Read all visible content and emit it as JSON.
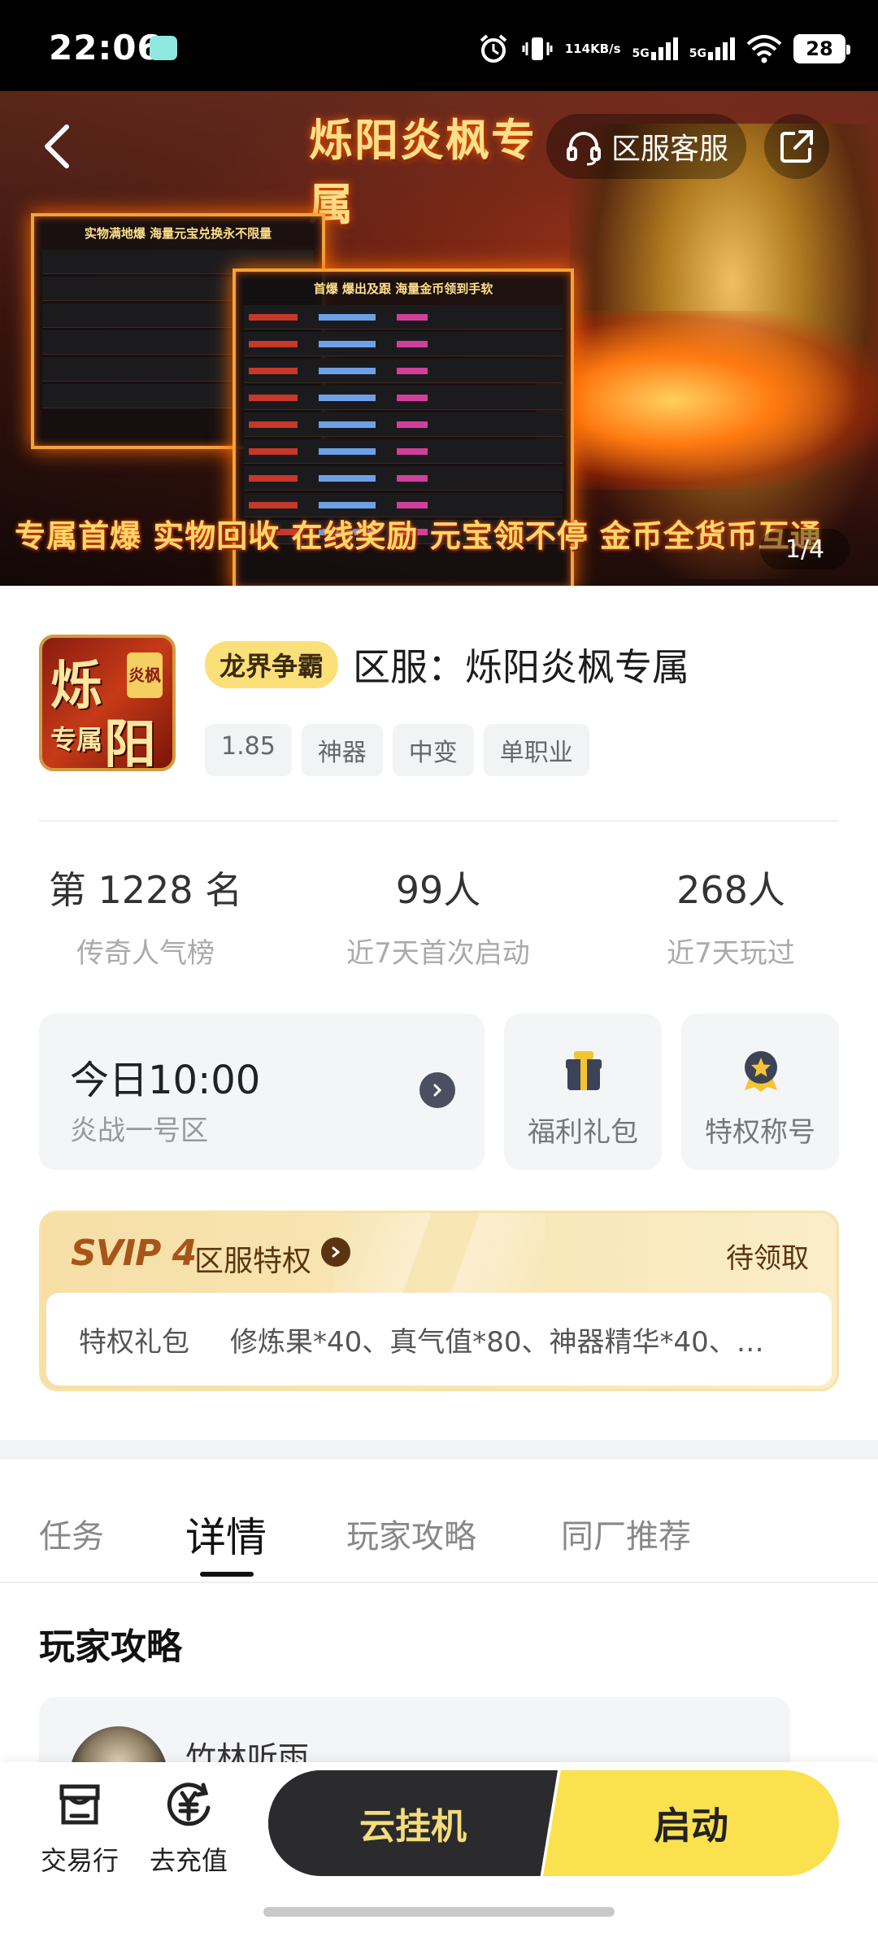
{
  "status_bar": {
    "time": "22:06",
    "net_speed_value": "114",
    "net_speed_unit": "KB/s",
    "signal_1": "5G",
    "signal_2": "5G",
    "battery": "28",
    "icons": [
      "alarm-icon",
      "vibrate-icon",
      "wifi-icon",
      "battery-icon"
    ]
  },
  "banner": {
    "title": "烁阳炎枫专属",
    "panel_left_title": "实物满地爆  海量元宝兑换永不限量",
    "panel_right_title": "首爆 爆出及跟  海量金币领到手软",
    "tagline": "专属首爆 实物回收 在线奖励 元宝领不停 金币全货币互通",
    "page_indicator": "1/4",
    "customer_service_label": "区服客服"
  },
  "game": {
    "logo_text": [
      "烁",
      "炎枫",
      "专属",
      "阳"
    ],
    "category": "龙界争霸",
    "title": "区服：烁阳炎枫专属",
    "tags": [
      "1.85",
      "神器",
      "中变",
      "单职业"
    ]
  },
  "stats": [
    {
      "value": "第 1228 名",
      "label": "传奇人气榜"
    },
    {
      "value": "99人",
      "label": "近7天首次启动"
    },
    {
      "value": "268人",
      "label": "近7天玩过"
    }
  ],
  "server": {
    "time": "今日10:00",
    "name": "炎战一号区"
  },
  "quick_cards": [
    {
      "label": "福利礼包",
      "icon": "gift-box-icon"
    },
    {
      "label": "特权称号",
      "icon": "star-medal-icon"
    }
  ],
  "svip": {
    "level": "SVIP 4",
    "title": "区服特权",
    "status": "待领取",
    "gift_label": "特权礼包",
    "gift_desc": "修炼果*40、真气值*80、神器精华*40、…"
  },
  "tabs": [
    "任务",
    "详情",
    "玩家攻略",
    "同厂推荐"
  ],
  "active_tab": "详情",
  "guides": {
    "section_title": "玩家攻略",
    "author": "竹林听雨"
  },
  "bottom_bar": {
    "trade_label": "交易行",
    "recharge_label": "去充值",
    "cloud_label": "云挂机",
    "launch_label": "启动"
  },
  "colors": {
    "accent_yellow": "#fbe14e",
    "dark_button": "#2b2b2e",
    "svip_brown": "#a8551a",
    "svip_bg": "#f7dfa6"
  }
}
